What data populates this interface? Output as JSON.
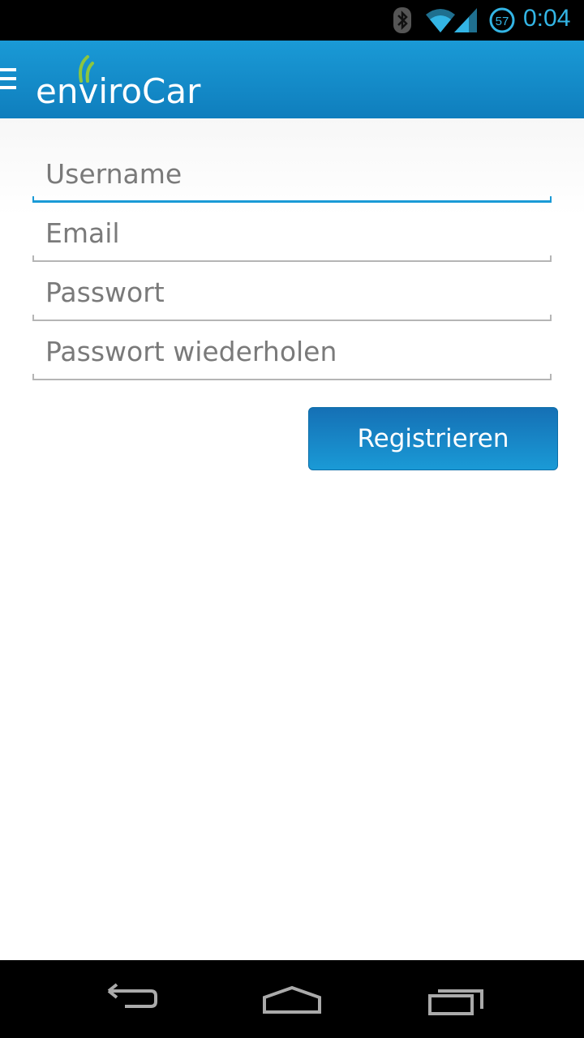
{
  "status_bar": {
    "time": "0:04",
    "battery_level": "57",
    "icons": [
      "bluetooth-icon",
      "wifi-icon",
      "cell-signal-icon",
      "battery-icon"
    ],
    "accent_color": "#33b5e5"
  },
  "action_bar": {
    "app_name": "enviroCar",
    "menu_icon": "hamburger-menu-icon",
    "background_color": "#1a9ad6"
  },
  "form": {
    "username": {
      "placeholder": "Username",
      "value": ""
    },
    "email": {
      "placeholder": "Email",
      "value": ""
    },
    "password": {
      "placeholder": "Passwort",
      "value": ""
    },
    "password_repeat": {
      "placeholder": "Passwort wiederholen",
      "value": ""
    },
    "focused_field": "username",
    "register_label": "Registrieren"
  },
  "nav_bar": {
    "icons": [
      "back-icon",
      "home-icon",
      "recent-apps-icon"
    ]
  }
}
